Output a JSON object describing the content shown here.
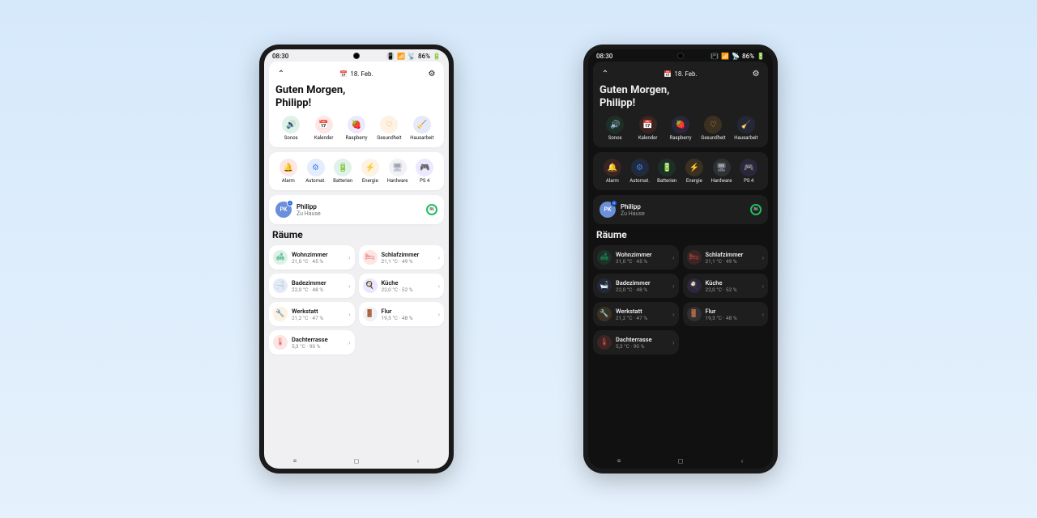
{
  "status": {
    "time": "08:30",
    "battery": "86%"
  },
  "header": {
    "date": "18. Feb."
  },
  "greeting": {
    "line1": "Guten Morgen,",
    "line2": "Philipp!"
  },
  "quick1": [
    {
      "label": "Sonos",
      "emoji": "🔊",
      "color": "#19a463"
    },
    {
      "label": "Kalender",
      "emoji": "📅",
      "color": "#e8534a"
    },
    {
      "label": "Raspberry",
      "emoji": "🍓",
      "color": "#7a5af0"
    },
    {
      "label": "Gesundheit",
      "emoji": "♡",
      "color": "#f2a33c"
    },
    {
      "label": "Hausarbeit",
      "emoji": "🧹",
      "color": "#4a6bd6"
    }
  ],
  "quick2": [
    {
      "label": "Alarm",
      "emoji": "🔔",
      "color": "#e8534a"
    },
    {
      "label": "Automat.",
      "emoji": "⚙",
      "color": "#3b82f6"
    },
    {
      "label": "Batterien",
      "emoji": "🔋",
      "color": "#19a463"
    },
    {
      "label": "Energie",
      "emoji": "⚡",
      "color": "#f2a33c"
    },
    {
      "label": "Hardware",
      "emoji": "🖥",
      "color": "#9ca3af"
    },
    {
      "label": "PS 4",
      "emoji": "🎮",
      "color": "#7a5af0"
    }
  ],
  "person": {
    "initials": "PK",
    "name": "Philipp",
    "location": "Zu Hause",
    "ring": "86"
  },
  "section_rooms": "Räume",
  "rooms": [
    {
      "name": "Wohnzimmer",
      "sub": "21,0 °C · 45 %",
      "emoji": "🛋",
      "color": "#19a463"
    },
    {
      "name": "Schlafzimmer",
      "sub": "21,1 °C · 49 %",
      "emoji": "🛏",
      "color": "#e8534a"
    },
    {
      "name": "Badezimmer",
      "sub": "22,0 °C · 48 %",
      "emoji": "🛁",
      "color": "#4a6bd6"
    },
    {
      "name": "Küche",
      "sub": "22,0 °C · 52 %",
      "emoji": "🍳",
      "color": "#8c5af0"
    },
    {
      "name": "Werkstatt",
      "sub": "21,2 °C · 47 %",
      "emoji": "🔧",
      "color": "#f2a33c"
    },
    {
      "name": "Flur",
      "sub": "19,3 °C · 48 %",
      "emoji": "🚪",
      "color": "#9ca3af"
    },
    {
      "name": "Dachterrasse",
      "sub": "5,3 °C · 90 %",
      "emoji": "🌡",
      "color": "#e8534a"
    }
  ]
}
